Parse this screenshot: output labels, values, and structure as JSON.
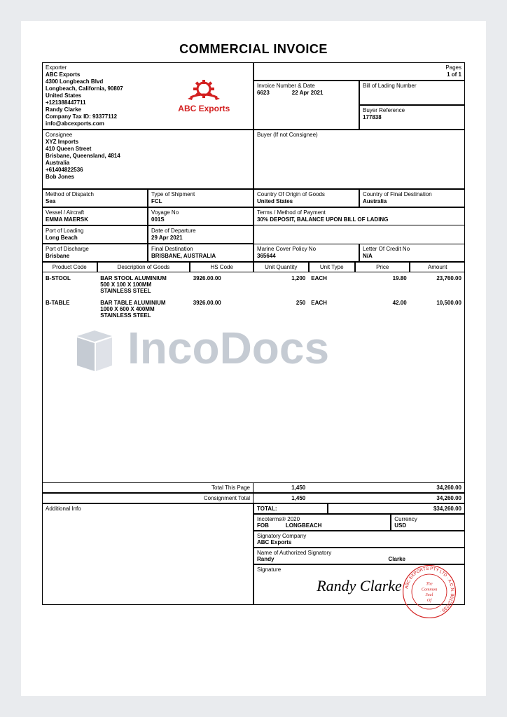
{
  "title": "COMMERCIAL INVOICE",
  "logo_text": "ABC Exports",
  "pages_label": "Pages",
  "pages": "1 of 1",
  "exporter": {
    "label": "Exporter",
    "name": "ABC Exports",
    "addr1": "4300 Longbeach Blvd",
    "addr2": "Longbeach, California, 90807",
    "country": "United States",
    "phone": "+121388447711",
    "contact": "Randy Clarke",
    "taxid": "Company Tax ID: 93377112",
    "email": "info@abcexports.com"
  },
  "invoice_num_label": "Invoice Number & Date",
  "invoice_num": "6623",
  "invoice_date": "22 Apr 2021",
  "bol_label": "Bill of Lading Number",
  "buyer_ref_label": "Buyer Reference",
  "buyer_ref": "177838",
  "consignee": {
    "label": "Consignee",
    "name": "XYZ Imports",
    "addr1": "410 Queen Street",
    "addr2": "Brisbane, Queensland, 4814",
    "country": "Australia",
    "phone": "+61404822536",
    "contact": "Bob Jones"
  },
  "buyer_label": "Buyer (If not Consignee)",
  "dispatch_label": "Method of Dispatch",
  "dispatch": "Sea",
  "shipment_type_label": "Type of Shipment",
  "shipment_type": "FCL",
  "origin_label": "Country Of Origin of Goods",
  "origin": "United States",
  "dest_country_label": "Country of Final Destination",
  "dest_country": "Australia",
  "vessel_label": "Vessel / Aircraft",
  "vessel": "EMMA MAERSK",
  "voyage_label": "Voyage No",
  "voyage": "001S",
  "terms_label": "Terms / Method of Payment",
  "terms": "30% DEPOSIT, BALANCE UPON BILL OF LADING",
  "pol_label": "Port of Loading",
  "pol": "Long Beach",
  "dep_label": "Date of Departure",
  "dep": "29 Apr 2021",
  "pod_label": "Port of Discharge",
  "pod": "Brisbane",
  "final_dest_label": "Final Destination",
  "final_dest": "BRISBANE, AUSTRALIA",
  "marine_label": "Marine Cover Policy No",
  "marine": "365644",
  "loc_label": "Letter Of Credit No",
  "loc": "N/A",
  "cols": {
    "code": "Product Code",
    "desc": "Description of Goods",
    "hs": "HS Code",
    "qty": "Unit Quantity",
    "unit": "Unit Type",
    "price": "Price",
    "amount": "Amount"
  },
  "items": [
    {
      "code": "B-STOOL",
      "desc1": "BAR STOOL ALUMINIUM",
      "desc2": "500 X 100 X 100MM",
      "desc3": "STAINLESS STEEL",
      "hs": "3926.00.00",
      "qty": "1,200",
      "unit": "EACH",
      "price": "19.80",
      "amount": "23,760.00"
    },
    {
      "code": "B-TABLE",
      "desc1": "BAR TABLE ALUMINIUM",
      "desc2": "1000 X 600 X 400MM",
      "desc3": "STAINLESS STEEL",
      "hs": "3926.00.00",
      "qty": "250",
      "unit": "EACH",
      "price": "42.00",
      "amount": "10,500.00"
    }
  ],
  "total_page_label": "Total This Page",
  "total_page_qty": "1,450",
  "total_page_amt": "34,260.00",
  "consign_total_label": "Consignment Total",
  "consign_total_qty": "1,450",
  "consign_total_amt": "34,260.00",
  "addl_label": "Additional Info",
  "total_label": "TOTAL:",
  "total": "$34,260.00",
  "incoterms_label": "Incoterms® 2020",
  "incoterms_term": "FOB",
  "incoterms_place": "LONGBEACH",
  "currency_label": "Currency",
  "currency": "USD",
  "sig_company_label": "Signatory Company",
  "sig_company": "ABC Exports",
  "sig_name_label": "Name of Authorized Signatory",
  "sig_first": "Randy",
  "sig_last": "Clarke",
  "signature_label": "Signature",
  "signature": "Randy Clarke",
  "seal_outer": "ABC EXPORTS PTY LTD · A.C.N. 86124239 ·",
  "seal_inner1": "The",
  "seal_inner2": "Common",
  "seal_inner3": "Seal",
  "seal_inner4": "Of",
  "watermark": "IncoDocs"
}
